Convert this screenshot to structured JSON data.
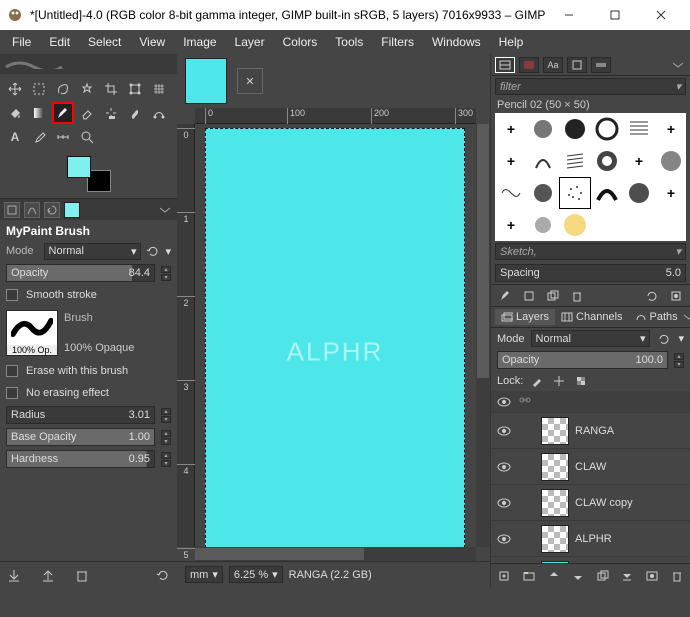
{
  "title": "*[Untitled]-4.0 (RGB color 8-bit gamma integer, GIMP built-in sRGB, 5 layers) 7016x9933 – GIMP",
  "menus": [
    "File",
    "Edit",
    "Select",
    "View",
    "Image",
    "Layer",
    "Colors",
    "Tools",
    "Filters",
    "Windows",
    "Help"
  ],
  "toolopts": {
    "title": "MyPaint Brush",
    "mode_label": "Mode",
    "mode_value": "Normal",
    "opacity_label": "Opacity",
    "opacity_value": "84.4",
    "smooth_label": "Smooth stroke",
    "brush_label": "Brush",
    "brush_preview_label": "100% Op.",
    "brush_desc": "100% Opaque",
    "erase_label": "Erase with this brush",
    "noerase_label": "No erasing effect",
    "radius_label": "Radius",
    "radius_value": "3.01",
    "baseop_label": "Base Opacity",
    "baseop_value": "1.00",
    "hardness_label": "Hardness",
    "hardness_value": "0.95"
  },
  "canvas": {
    "watermark": "ALPHR",
    "ruler_ticks_h": [
      "0",
      "100",
      "200",
      "300"
    ],
    "ruler_ticks_v": [
      "0",
      "1",
      "2",
      "3",
      "4",
      "5"
    ]
  },
  "status": {
    "unit": "mm",
    "zoom": "6.25 %",
    "layer_info": "RANGA (2.2 GB)"
  },
  "brushpanel": {
    "filter_placeholder": "filter",
    "current": "Pencil 02 (50 × 50)",
    "bottom_dropdown": "Sketch,",
    "spacing_label": "Spacing",
    "spacing_value": "5.0"
  },
  "layers": {
    "tab_layers": "Layers",
    "tab_channels": "Channels",
    "tab_paths": "Paths",
    "mode_label": "Mode",
    "mode_value": "Normal",
    "opacity_label": "Opacity",
    "opacity_value": "100.0",
    "lock_label": "Lock:",
    "items": [
      {
        "name": "RANGA",
        "solid": false
      },
      {
        "name": "CLAW",
        "solid": false
      },
      {
        "name": "CLAW copy",
        "solid": false
      },
      {
        "name": "ALPHR",
        "solid": false
      },
      {
        "name": "",
        "solid": true
      }
    ]
  }
}
